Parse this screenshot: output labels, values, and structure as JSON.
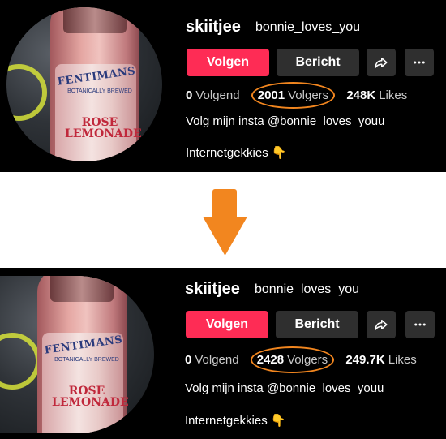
{
  "profile_before": {
    "username": "skiitjee",
    "nickname": "bonnie_loves_you",
    "follow_label": "Volgen",
    "message_label": "Bericht",
    "stats": {
      "following_count": "0",
      "following_label": "Volgend",
      "followers_count": "2001",
      "followers_label": "Volgers",
      "likes_count": "248K",
      "likes_label": "Likes"
    },
    "bio": "Volg mijn insta @bonnie_loves_youu",
    "link_text": "Internetgekkies",
    "emoji": "👇"
  },
  "profile_after": {
    "username": "skiitjee",
    "nickname": "bonnie_loves_you",
    "follow_label": "Volgen",
    "message_label": "Bericht",
    "stats": {
      "following_count": "0",
      "following_label": "Volgend",
      "followers_count": "2428",
      "followers_label": "Volgers",
      "likes_count": "249.7K",
      "likes_label": "Likes"
    },
    "bio": "Volg mijn insta @bonnie_loves_youu",
    "link_text": "Internetgekkies",
    "emoji": "👇"
  },
  "avatar_text": {
    "brand": "FENTIMANS",
    "sub": "BOTANICALLY BREWED",
    "product": "ROSE LEMONADE"
  },
  "icons": {
    "share": "share-icon",
    "more": "more-icon",
    "arrow": "down-arrow-icon"
  },
  "colors": {
    "panel_bg": "#000000",
    "follow_button": "#fe2c55",
    "secondary_button": "#2f2f2f",
    "highlight_ring": "#f2861f",
    "arrow": "#f2861f"
  }
}
